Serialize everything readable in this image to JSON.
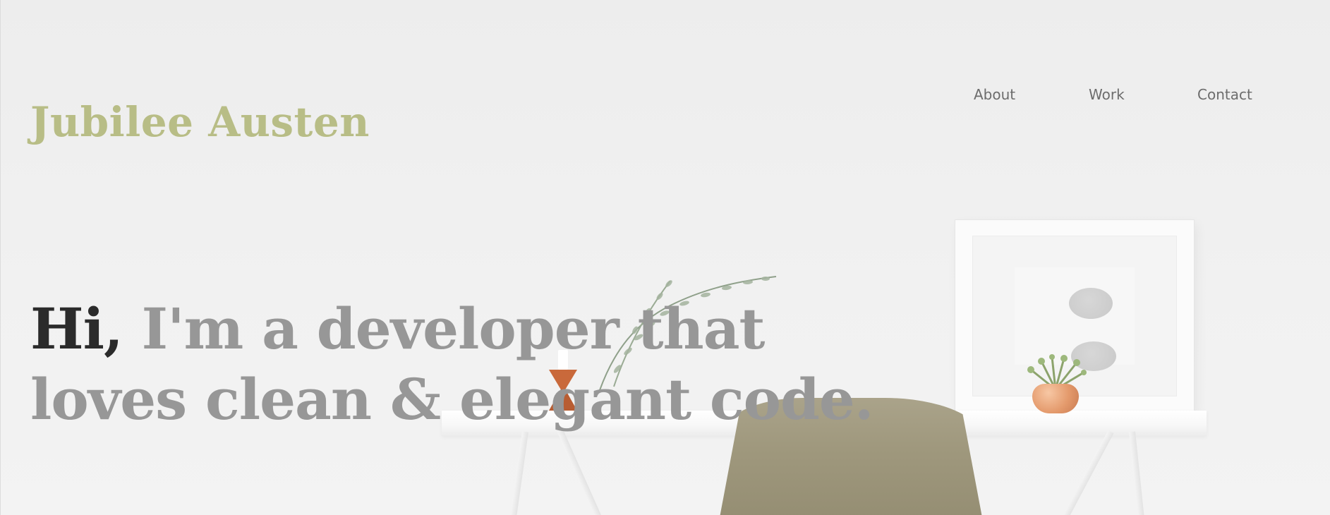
{
  "site": {
    "name": "Jubilee Austen",
    "brand_color": "#b8bd86"
  },
  "nav": {
    "items": [
      {
        "label": "About"
      },
      {
        "label": "Work"
      },
      {
        "label": "Contact"
      }
    ]
  },
  "hero": {
    "greeting": "Hi,",
    "tagline_line1": " I'm a developer that",
    "tagline_line2": "loves clean & elegant code.",
    "greeting_color": "#2b2b2b",
    "tagline_color": "#979797"
  }
}
